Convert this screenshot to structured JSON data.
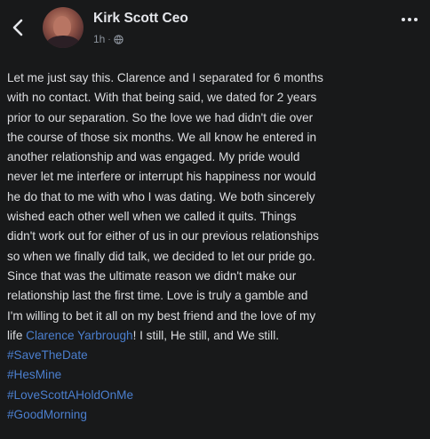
{
  "header": {
    "author_name": "Kirk Scott Ceo",
    "timestamp": "1h",
    "separator": "·",
    "privacy_icon": "globe-icon",
    "back_icon": "back-arrow-icon",
    "more_icon": "more-options-icon"
  },
  "post": {
    "lines": [
      "Let me just say this. Clarence and I separated for 6 months",
      "with no contact. With that being said, we dated for 2 years",
      "prior to our separation. So the love we had didn't die over",
      "the course of those six months. We all know he entered in",
      "another relationship and was engaged. My pride would",
      "never let me interfere or interrupt his happiness nor would",
      "he do that to me with who I was dating. We both sincerely",
      "wished each other well when we called it quits. Things",
      "didn't work out for either of us in our previous relationships",
      "so when we finally did talk, we decided to let our pride go.",
      "Since that was the ultimate reason we didn't make our",
      "relationship last the first time. Love is truly a gamble and",
      "I'm willing to bet it all on my best friend and the love of my"
    ],
    "last_line_prefix": "life ",
    "mention": "Clarence Yarbrough",
    "last_line_suffix": "! I still, He still, and We still.",
    "hashtags": [
      "#SaveTheDate",
      "#HesMine",
      "#LoveScottAHoldOnMe",
      "#GoodMorning"
    ]
  },
  "colors": {
    "background": "#18191a",
    "text": "#dcdde0",
    "link": "#4b7fcf",
    "meta": "#8d949e"
  }
}
